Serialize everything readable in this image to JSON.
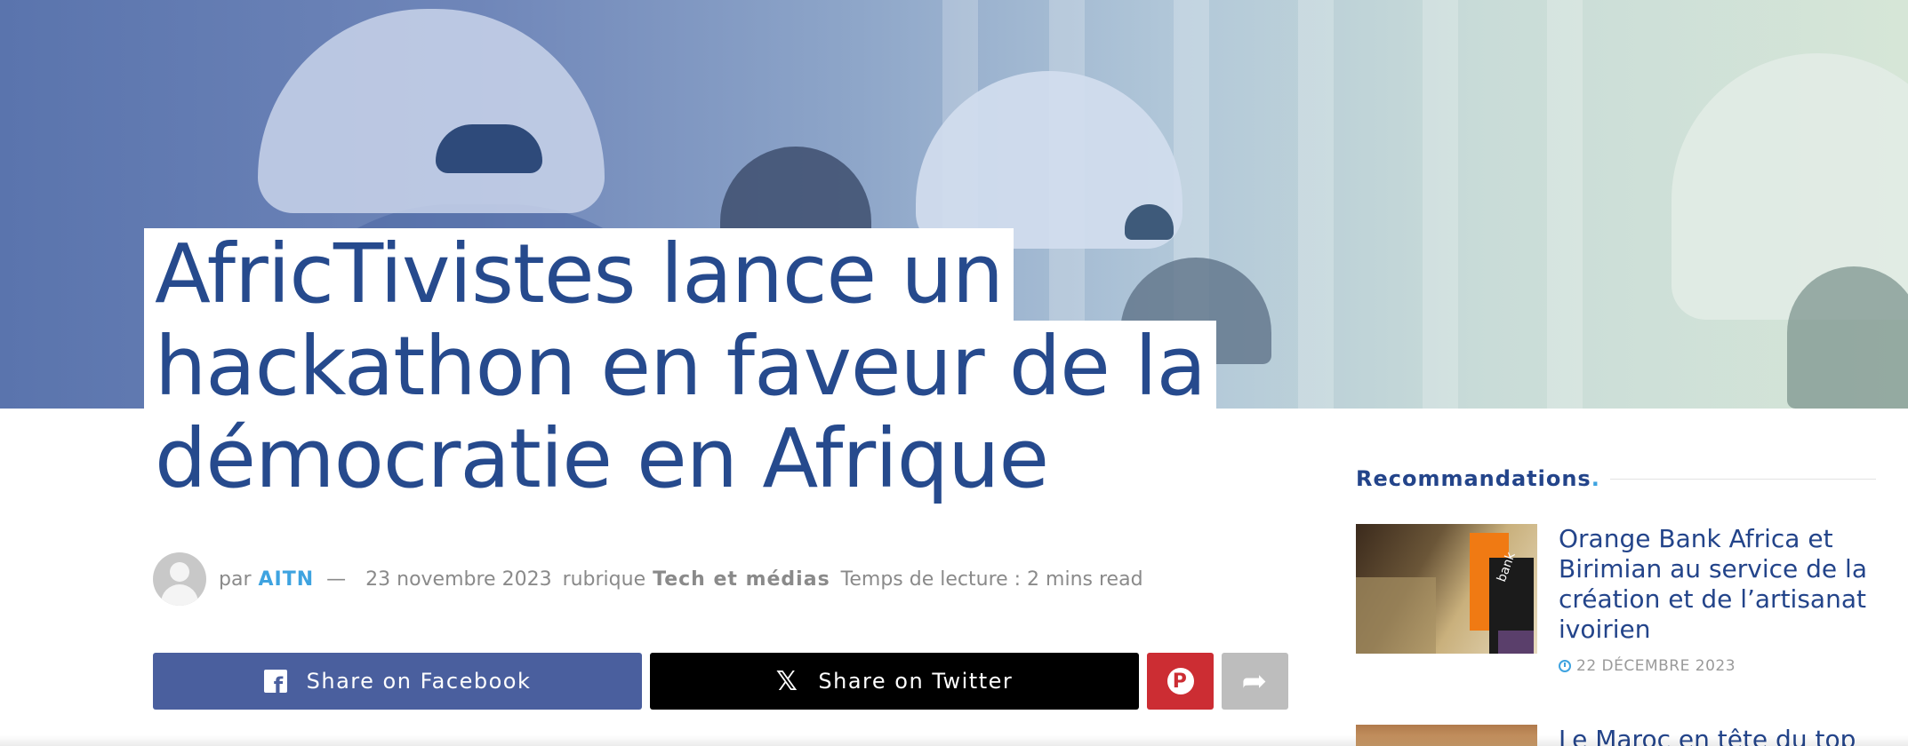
{
  "article": {
    "title_lines": [
      "AfricTivistes lance un",
      "hackathon en faveur de la",
      "démocratie en Afrique"
    ],
    "by_label": "par",
    "author": "AITN",
    "separator": "—",
    "date": "23 novembre 2023",
    "category_label": "rubrique",
    "category": "Tech et médias",
    "reading_time": "Temps de lecture : 2 mins read"
  },
  "share": {
    "facebook_label": "Share on Facebook",
    "twitter_label": "Share on Twitter",
    "facebook_icon": "f",
    "twitter_icon": "𝕏",
    "pinterest_icon": "P",
    "more_icon": "➦"
  },
  "sidebar": {
    "heading": "Recommandations",
    "heading_dot": ".",
    "items": [
      {
        "title": "Orange Bank Africa et Birimian au service de la création et de l’artisanat ivoirien",
        "date": "22 DÉCEMBRE 2023",
        "thumb_text": "bank"
      },
      {
        "title": "Le Maroc en tête du top"
      }
    ]
  },
  "colors": {
    "title": "#264a8d",
    "accent": "#3ea3e0",
    "facebook": "#4a5f9e",
    "twitter": "#000000",
    "pinterest": "#cc2d33",
    "more": "#bdbdbd"
  }
}
